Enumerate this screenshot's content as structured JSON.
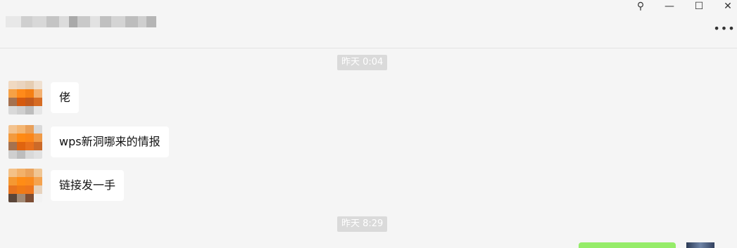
{
  "window": {
    "pin_icon": "pin-icon",
    "minimize_icon": "minimize-icon",
    "maximize_icon": "maximize-icon",
    "close_icon": "close-icon",
    "more_icon": "more-icon",
    "pin_glyph": "⚲",
    "minimize_glyph": "—",
    "maximize_glyph": "☐",
    "close_glyph": "✕",
    "more_glyph": "•••"
  },
  "chat": {
    "timestamps": [
      "昨天 0:04",
      "昨天 8:29"
    ],
    "messages": [
      {
        "text": "佬"
      },
      {
        "text": "wps新洞哪来的情报"
      },
      {
        "text": "链接发一手"
      }
    ]
  },
  "colors": {
    "background": "#f5f5f5",
    "bubble_incoming": "#ffffff",
    "bubble_outgoing": "#95ec69",
    "timestamp_bg": "#dadada"
  }
}
